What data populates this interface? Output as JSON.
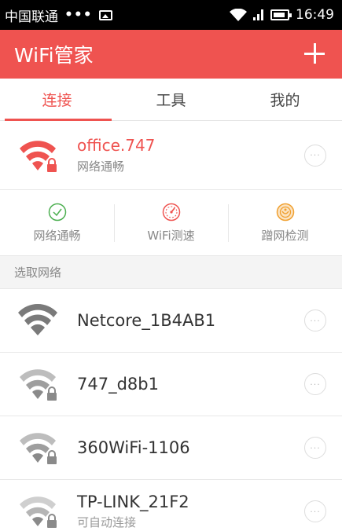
{
  "status_bar": {
    "carrier": "中国联通",
    "dots": "•••",
    "time": "16:49"
  },
  "app_bar": {
    "title": "WiFi管家",
    "add_icon": "plus-icon"
  },
  "tabs": [
    {
      "label": "连接",
      "active": true
    },
    {
      "label": "工具",
      "active": false
    },
    {
      "label": "我的",
      "active": false
    }
  ],
  "connected": {
    "name": "office.747",
    "status": "网络通畅",
    "more": "···"
  },
  "tools": [
    {
      "label": "网络通畅",
      "icon": "check-circle-icon",
      "color": "#4caf50"
    },
    {
      "label": "WiFi测速",
      "icon": "speedometer-icon",
      "color": "#ef5350"
    },
    {
      "label": "蹭网检测",
      "icon": "detect-icon",
      "color": "#f0a030"
    }
  ],
  "section_title": "选取网络",
  "networks": [
    {
      "name": "Netcore_1B4AB1",
      "sub": "",
      "locked": false,
      "more": "···"
    },
    {
      "name": "747_d8b1",
      "sub": "",
      "locked": true,
      "more": "···"
    },
    {
      "name": "360WiFi-1106",
      "sub": "",
      "locked": true,
      "more": "···"
    },
    {
      "name": "TP-LINK_21F2",
      "sub": "可自动连接",
      "locked": true,
      "more": "···"
    }
  ],
  "colors": {
    "accent": "#ef5350",
    "wifi_gray": "#8a8a8a"
  }
}
